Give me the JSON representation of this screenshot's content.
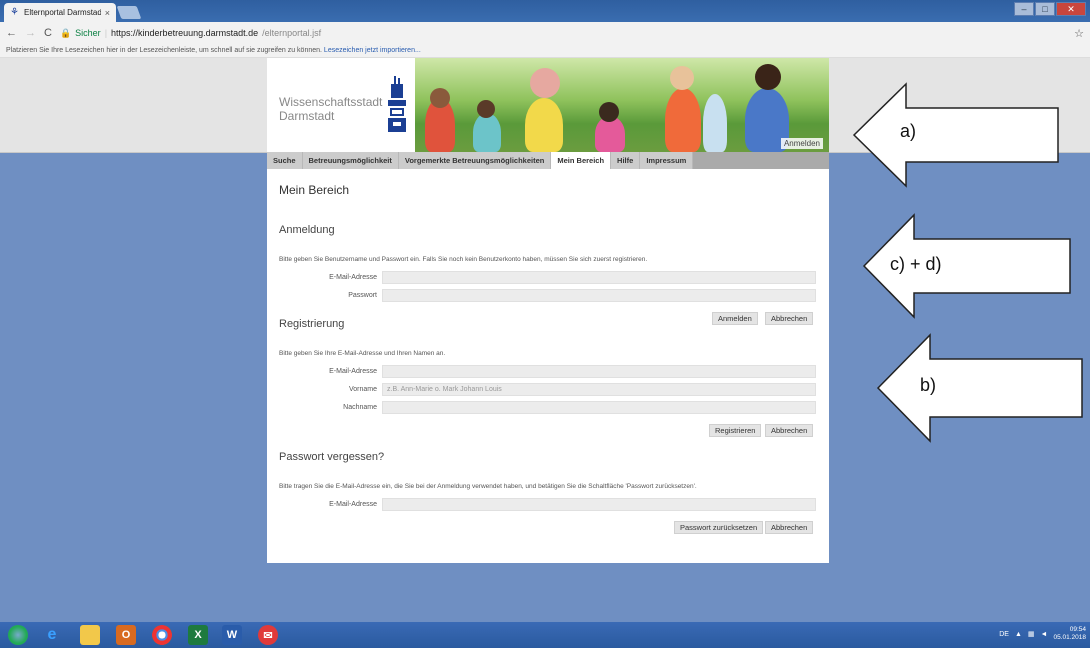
{
  "browser": {
    "tab_title": "Elternportal Darmstadt",
    "tab_close": "×",
    "secure_label": "Sicher",
    "url_host": "https://kinderbetreuung.darmstadt.de",
    "url_path": "/elternportal.jsf",
    "bookmark_hint": "Platzieren Sie Ihre Lesezeichen hier in der Lesezeichenleiste, um schnell auf sie zugreifen zu können.",
    "bookmark_import": "Lesezeichen jetzt importieren..."
  },
  "header": {
    "logo_line1": "Wissenschaftsstadt",
    "logo_line2": "Darmstadt",
    "login_link": "Anmelden"
  },
  "nav": {
    "items": [
      {
        "label": "Suche"
      },
      {
        "label": "Betreuungsmöglichkeit"
      },
      {
        "label": "Vorgemerkte Betreuungsmöglichkeiten"
      },
      {
        "label": "Mein Bereich"
      },
      {
        "label": "Hilfe"
      },
      {
        "label": "Impressum"
      }
    ],
    "active": "Mein Bereich"
  },
  "main": {
    "title": "Mein Bereich",
    "login": {
      "heading": "Anmeldung",
      "info": "Bitte geben Sie Benutzername und Passwort ein. Falls Sie noch kein Benutzerkonto haben, müssen Sie sich zuerst registrieren.",
      "email_label": "E-Mail-Adresse",
      "email_value": "",
      "password_label": "Passwort",
      "password_value": "",
      "submit": "Anmelden",
      "cancel": "Abbrechen"
    },
    "register": {
      "heading": "Registrierung",
      "info": "Bitte geben Sie Ihre E-Mail-Adresse und Ihren Namen an.",
      "email_label": "E-Mail-Adresse",
      "firstname_label": "Vorname",
      "firstname_placeholder": "z.B. Ann-Marie o. Mark Johann Louis",
      "lastname_label": "Nachname",
      "submit": "Registrieren",
      "cancel": "Abbrechen"
    },
    "forgot": {
      "heading": "Passwort vergessen?",
      "info": "Bitte tragen Sie die E-Mail-Adresse ein, die Sie bei der Anmeldung verwendet haben, und betätigen Sie die Schaltfläche 'Passwort zurücksetzen'.",
      "email_label": "E-Mail-Adresse",
      "submit": "Passwort zurücksetzen",
      "cancel": "Abbrechen"
    }
  },
  "annotations": {
    "a": "a)",
    "cd": "c) + d)",
    "b": "b)"
  },
  "taskbar": {
    "lang": "DE",
    "time": "09:54",
    "date": "05.01.2018"
  },
  "colors": {
    "page_background": "#6f8fc2",
    "nav_active": "#ffffff",
    "secure_green": "#0b8043"
  }
}
